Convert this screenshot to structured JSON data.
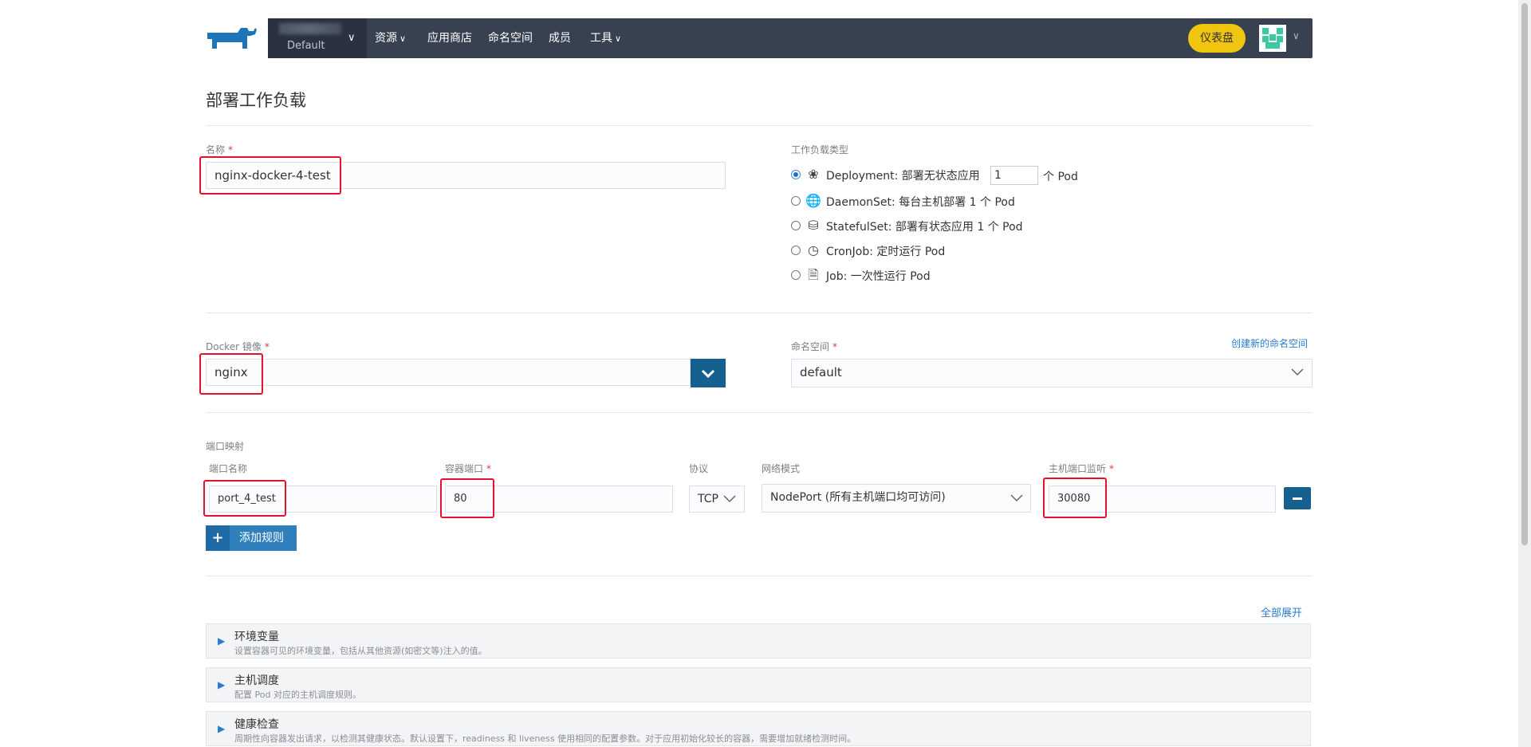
{
  "header": {
    "cluster_name": "Default",
    "nav": [
      {
        "label": "资源",
        "has_caret": true
      },
      {
        "label": "应用商店",
        "has_caret": false
      },
      {
        "label": "命名空间",
        "has_caret": false
      },
      {
        "label": "成员",
        "has_caret": false
      },
      {
        "label": "工具",
        "has_caret": true
      }
    ],
    "dashboard_button": "仪表盘",
    "icons": [
      "rancher-logo-icon",
      "chevron-down-icon",
      "avatar-icon"
    ]
  },
  "page_title": "部署工作负载",
  "form": {
    "name": {
      "label": "名称",
      "value": "nginx-docker-4-test"
    },
    "workload_type": {
      "label": "工作负载类型",
      "options": [
        {
          "icon": "deployment-icon",
          "text": "Deployment: 部署无状态应用",
          "selected": true
        },
        {
          "icon": "globe-icon",
          "text": "DaemonSet: 每台主机部署 1 个 Pod",
          "selected": false
        },
        {
          "icon": "database-icon",
          "text": "StatefulSet: 部署有状态应用 1 个 Pod",
          "selected": false
        },
        {
          "icon": "clock-icon",
          "text": "CronJob: 定时运行 Pod",
          "selected": false
        },
        {
          "icon": "document-icon",
          "text": "Job: 一次性运行 Pod",
          "selected": false
        }
      ],
      "scale_value": "1",
      "scale_suffix": "个 Pod"
    },
    "docker_image": {
      "label": "Docker 镜像",
      "value": "nginx"
    },
    "namespace": {
      "label": "命名空间",
      "value": "default",
      "create_link": "创建新的命名空间"
    },
    "port_mapping": {
      "section_label": "端口映射",
      "col_port_name": "端口名称",
      "col_container_port": "容器端口",
      "col_protocol": "协议",
      "col_network_mode": "网络模式",
      "col_host_port": "主机端口监听",
      "row": {
        "port_name": "port_4_test",
        "container_port": "80",
        "protocol": "TCP",
        "network_mode": "NodePort (所有主机端口均可访问)",
        "host_port": "30080"
      },
      "add_rule": "添加规则"
    },
    "expand_all": "全部展开",
    "sections": [
      {
        "title": "环境变量",
        "desc": "设置容器可见的环境变量，包括从其他资源(如密文等)注入的值。"
      },
      {
        "title": "主机调度",
        "desc": "配置 Pod 对应的主机调度规则。"
      },
      {
        "title": "健康检查",
        "desc": "周期性向容器发出请求，以检测其健康状态。默认设置下，readiness 和 liveness 使用相同的配置参数。对于应用初始化较长的容器，需要增加就绪检测时间。"
      }
    ]
  },
  "required_mark": "*",
  "colors": {
    "navbar": "#384150",
    "accent": "#15608f",
    "dashboard": "#f1c40f",
    "highlight": "#e8112d"
  }
}
